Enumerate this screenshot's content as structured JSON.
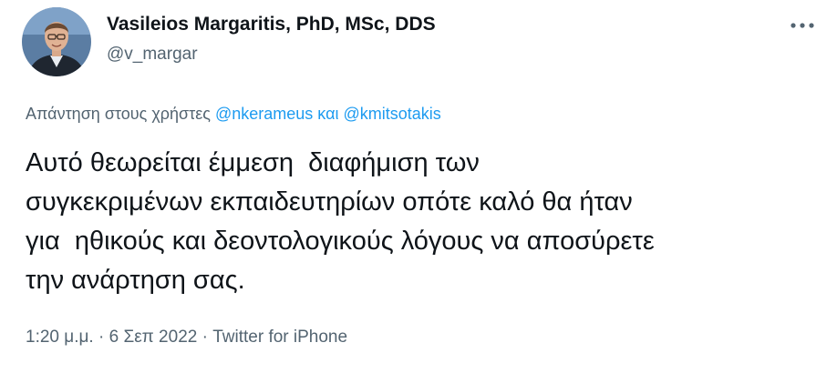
{
  "user": {
    "display_name": "Vasileios Margaritis, PhD, MSc, DDS",
    "handle": "@v_margar"
  },
  "reply": {
    "prefix": "Απάντηση στους χρήστες",
    "mention1": "@nkerameus",
    "conjunction": "και",
    "mention2": "@kmitsotakis"
  },
  "tweet": {
    "lines": [
      "Αυτό θεωρείται έμμεση  διαφήμιση των",
      "συγκεκριμένων εκπαιδευτηρίων οπότε καλό θα ήταν",
      "για  ηθικούς και δεοντολογικούς λόγους να αποσύρετε",
      "την ανάρτηση σας."
    ]
  },
  "meta": {
    "time": "1:20 μ.μ.",
    "separator": "·",
    "date": "6 Σεπ 2022",
    "source": "Twitter for iPhone"
  },
  "icons": {
    "more": "more-options-icon",
    "avatar": "profile-avatar"
  },
  "colors": {
    "text": "#0f1419",
    "secondary": "#536471",
    "link": "#1d9bf0"
  }
}
